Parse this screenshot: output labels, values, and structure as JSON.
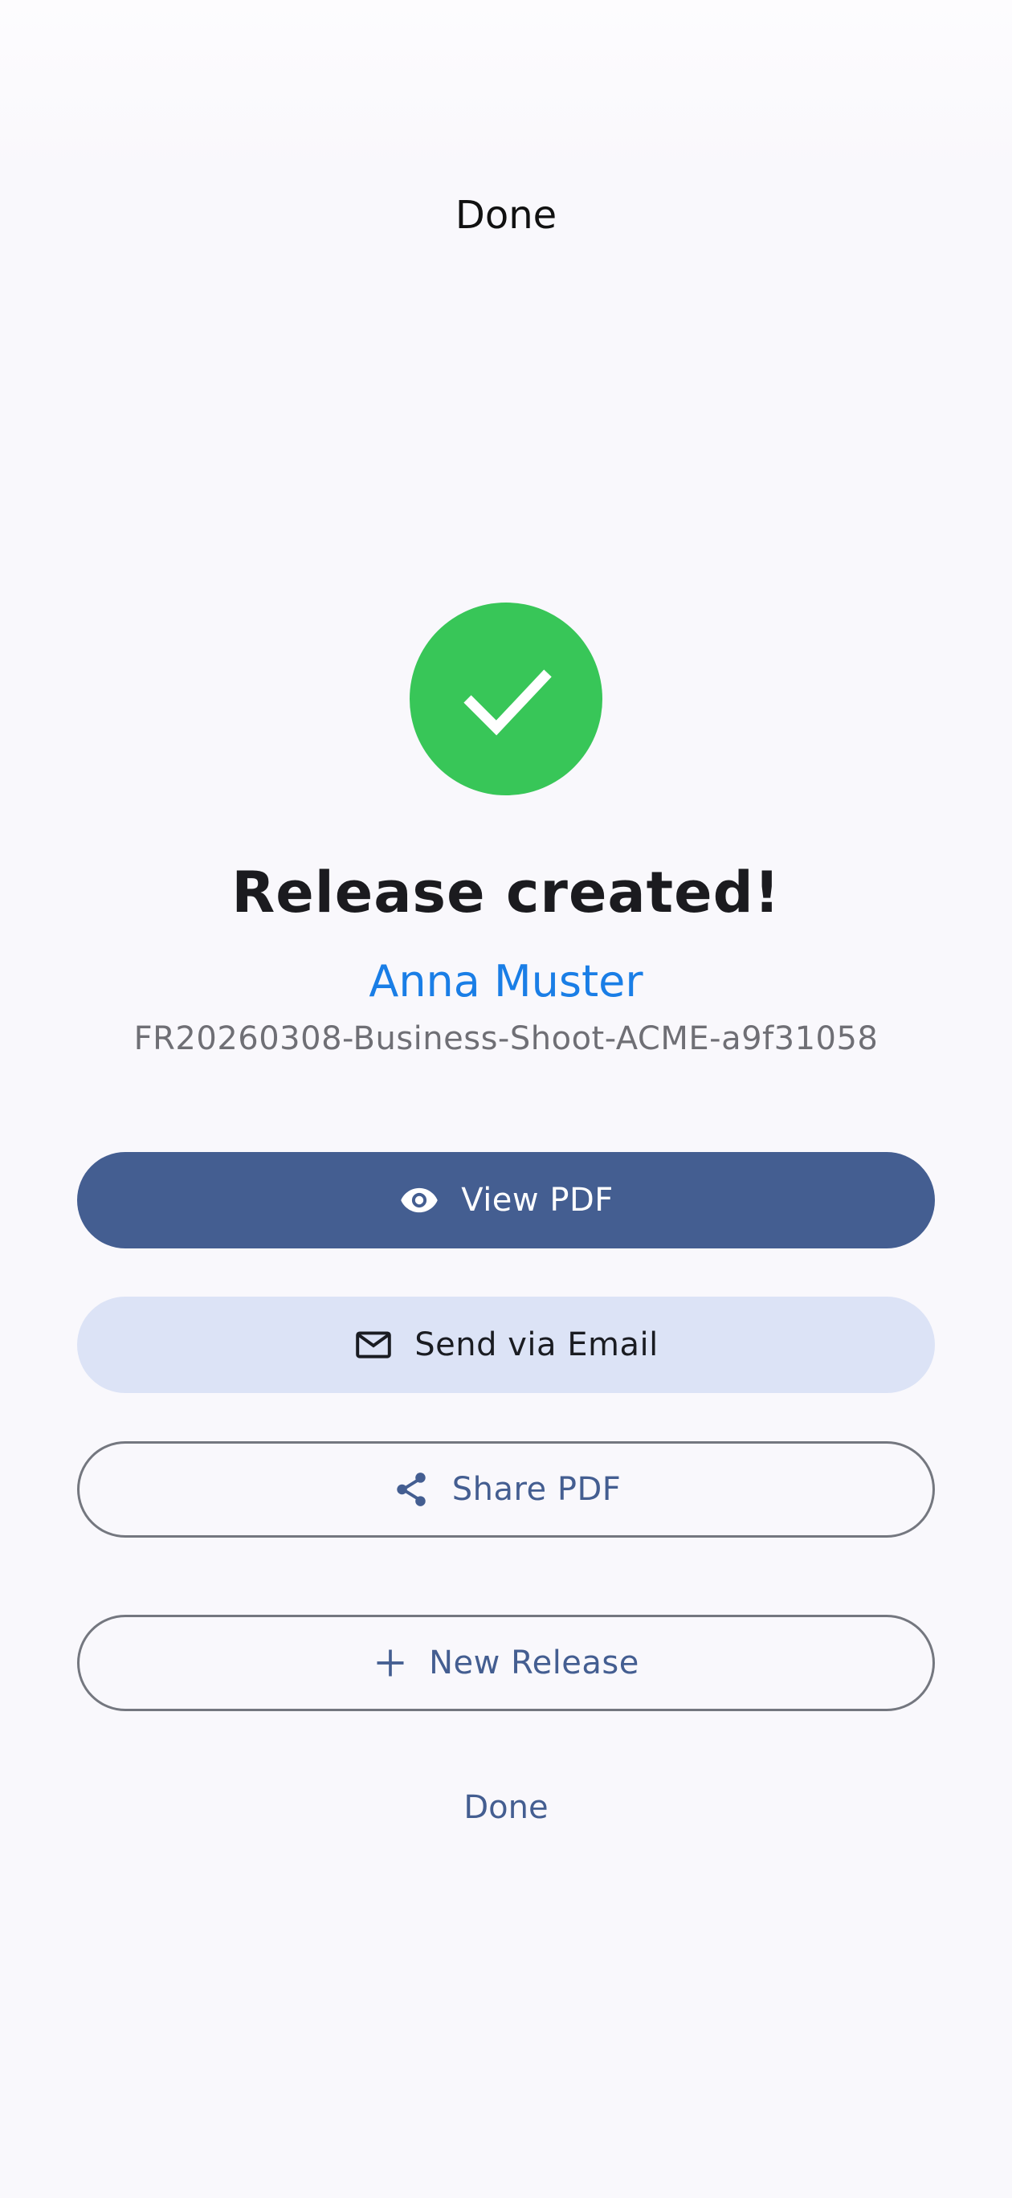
{
  "header": {
    "title": "Done"
  },
  "success": {
    "icon": "check-icon",
    "color": "#38c658"
  },
  "main": {
    "title": "Release created!",
    "person_name": "Anna Muster",
    "release_id": "FR20260308-Business-Shoot-ACME-a9f31058"
  },
  "actions": {
    "view_pdf": {
      "label": "View PDF",
      "icon": "eye-icon"
    },
    "send_email": {
      "label": "Send via Email",
      "icon": "mail-icon"
    },
    "share_pdf": {
      "label": "Share PDF",
      "icon": "share-icon"
    },
    "new_release": {
      "label": "New Release",
      "icon": "plus-icon"
    },
    "done": {
      "label": "Done"
    }
  },
  "colors": {
    "primary": "#445e91",
    "secondary_container": "#dce3f6",
    "accent_name": "#1a7ee6",
    "background": "#f9f8fc"
  }
}
